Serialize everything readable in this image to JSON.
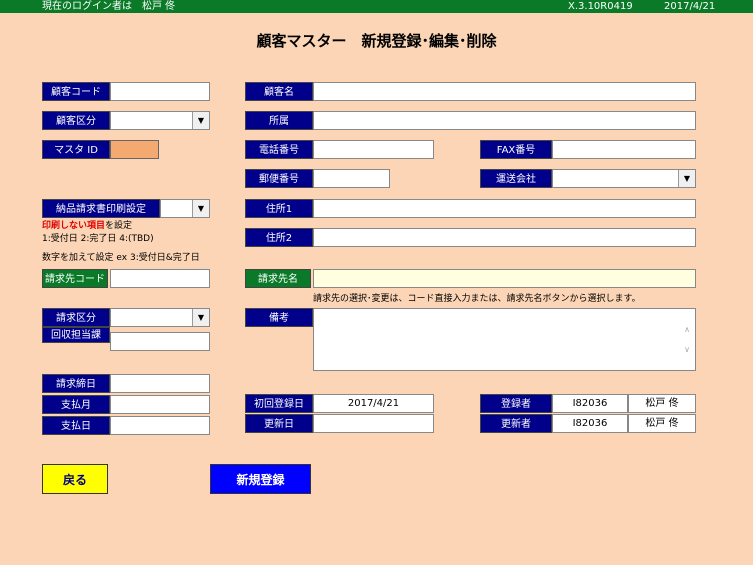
{
  "header": {
    "login_text": "現在のログイン者は　松戸 佟",
    "version": "X.3.10R0419",
    "date": "2017/4/21"
  },
  "title": "顧客マスター　新規登録･編集･削除",
  "fields": {
    "customer_code": "顧客コード",
    "customer_name": "顧客名",
    "customer_class": "顧客区分",
    "affiliation": "所属",
    "master_id": "マスタ ID",
    "phone": "電話番号",
    "fax": "FAX番号",
    "postal": "郵便番号",
    "carrier": "運送会社",
    "invoice_print": "納品請求書印刷設定",
    "address1": "住所1",
    "address2": "住所2",
    "billing_code": "請求先コード",
    "billing_name": "請求先名",
    "billing_class": "請求区分",
    "collection_dept": "回収担当課",
    "remarks": "備考",
    "closing_day": "請求締日",
    "payment_month": "支払月",
    "payment_day": "支払日",
    "first_reg_date": "初回登録日",
    "updated_date": "更新日",
    "registrant": "登録者",
    "updater": "更新者"
  },
  "notes": {
    "no_print_red": "印刷しない項目",
    "no_print_rest": "を設定",
    "codes": "1:受付日 2:完了日 4:(TBD)",
    "sum": "数字を加えて設定 ex 3:受付日&完了日",
    "billing_hint": "請求先の選択･変更は、コード直接入力または、請求先名ボタンから選択します。"
  },
  "values": {
    "first_reg_date": "2017/4/21",
    "updated_date": "",
    "registrant_id": "I82036",
    "registrant_name": "松戸 佟",
    "updater_id": "I82036",
    "updater_name": "松戸 佟"
  },
  "buttons": {
    "back": "戻る",
    "new_register": "新規登録"
  },
  "colors": {
    "background": "#FBD5B5",
    "label_bg": "#00008B",
    "green": "#0A7A28",
    "back_btn": "#FFFF00",
    "new_btn": "#0000FF"
  }
}
